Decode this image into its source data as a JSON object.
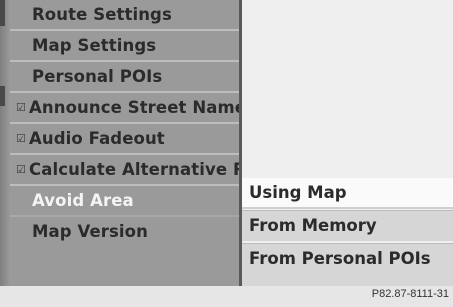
{
  "menu": {
    "items": [
      {
        "label": "Route Settings",
        "checked": false
      },
      {
        "label": "Map Settings",
        "checked": false
      },
      {
        "label": "Personal POIs",
        "checked": false
      },
      {
        "label": "Announce Street Names",
        "checked": true
      },
      {
        "label": "Audio Fadeout",
        "checked": true
      },
      {
        "label": "Calculate Alternative Routes",
        "checked": true
      },
      {
        "label": "Avoid Area",
        "checked": false,
        "selected": true
      },
      {
        "label": "Map Version",
        "checked": false
      }
    ],
    "check_icon": "checkmark-icon"
  },
  "submenu": {
    "items": [
      {
        "label": "Using Map"
      },
      {
        "label": "From Memory"
      },
      {
        "label": "From Personal POIs"
      }
    ]
  },
  "footer": {
    "code": "P82.87-8111-31"
  },
  "colors": {
    "menu_bg": "#9a9a9a",
    "submenu_highlight": "#fafafa",
    "submenu_bg": "#d6d6d6",
    "selected_text": "#f4f4f4"
  }
}
